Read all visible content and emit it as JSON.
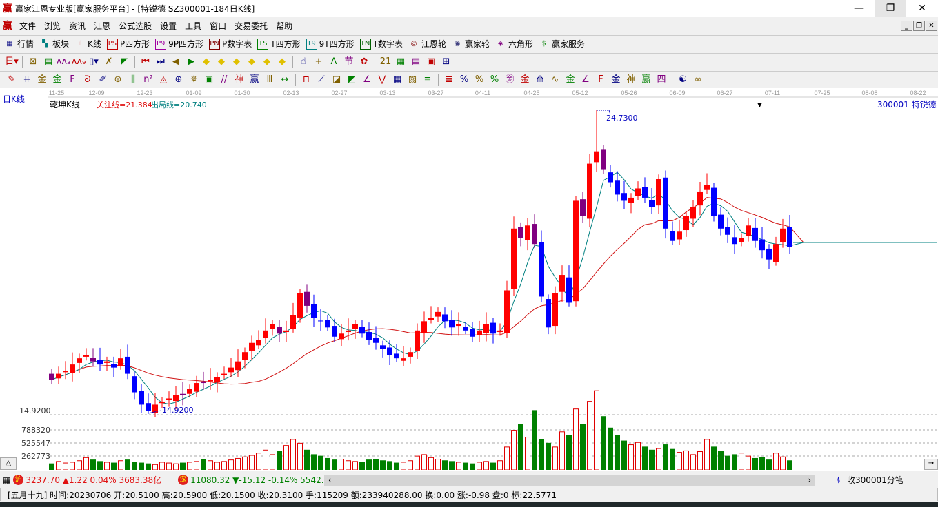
{
  "window": {
    "title": "赢家江恩专业版[赢家服务平台] - [特锐德  SZ300001-184日K线]",
    "logo": "赢"
  },
  "menu": [
    "文件",
    "浏览",
    "资讯",
    "江恩",
    "公式选股",
    "设置",
    "工具",
    "窗口",
    "交易委托",
    "帮助"
  ],
  "toolbar1": [
    {
      "icon": "grid",
      "glyph": "▦",
      "label": "行情",
      "color": "#000080"
    },
    {
      "icon": "blocks",
      "glyph": "▚",
      "label": "板块",
      "color": "#008080"
    },
    {
      "icon": "kline",
      "glyph": "ıl",
      "label": "K线",
      "color": "#c00000"
    },
    {
      "icon": "ps",
      "glyph": "PS",
      "label": "P四方形",
      "color": "#c00000"
    },
    {
      "icon": "p9",
      "glyph": "P9",
      "label": "9P四方形",
      "color": "#a000a0"
    },
    {
      "icon": "pn",
      "glyph": "PN",
      "label": "P数字表",
      "color": "#800000"
    },
    {
      "icon": "ts",
      "glyph": "TS",
      "label": "T四方形",
      "color": "#008000"
    },
    {
      "icon": "t9",
      "glyph": "T9",
      "label": "9T四方形",
      "color": "#008080"
    },
    {
      "icon": "tn",
      "glyph": "TN",
      "label": "T数字表",
      "color": "#006000"
    },
    {
      "icon": "gann-wheel",
      "glyph": "◎",
      "label": "江恩轮",
      "color": "#800000"
    },
    {
      "icon": "winner-wheel",
      "glyph": "◉",
      "label": "赢家轮",
      "color": "#404080"
    },
    {
      "icon": "hexagon",
      "glyph": "◈",
      "label": "六角形",
      "color": "#800080"
    },
    {
      "icon": "dollar",
      "glyph": "$",
      "label": "赢家服务",
      "color": "#008000"
    }
  ],
  "toolbar2": [
    {
      "icon": "period-select",
      "glyph": "日▾"
    },
    {
      "icon": "sep"
    },
    {
      "icon": "pattern",
      "glyph": "⊠"
    },
    {
      "icon": "notes",
      "glyph": "▤"
    },
    {
      "icon": "wave3",
      "glyph": "ʌʌ₃"
    },
    {
      "icon": "wave9",
      "glyph": "ʌʌ₉"
    },
    {
      "icon": "candle-select",
      "glyph": "▯▾"
    },
    {
      "icon": "mark",
      "glyph": "✗"
    },
    {
      "icon": "spectrum",
      "glyph": "◤"
    },
    {
      "icon": "sep"
    },
    {
      "icon": "first",
      "glyph": "⏮"
    },
    {
      "icon": "last",
      "glyph": "⏭"
    },
    {
      "icon": "prev",
      "glyph": "◀"
    },
    {
      "icon": "next",
      "glyph": "▶"
    },
    {
      "icon": "left-diamond",
      "glyph": "◆"
    },
    {
      "icon": "right-diamond",
      "glyph": "◆"
    },
    {
      "icon": "expand-diamond",
      "glyph": "◆"
    },
    {
      "icon": "shrink-diamond",
      "glyph": "◆"
    },
    {
      "icon": "vshrink-diamond",
      "glyph": "◆"
    },
    {
      "icon": "vexpand-diamond",
      "glyph": "◆"
    },
    {
      "icon": "sep"
    },
    {
      "icon": "hand",
      "glyph": "☝"
    },
    {
      "icon": "crosshair",
      "glyph": "+"
    },
    {
      "icon": "line-draw",
      "glyph": "ᐱ"
    },
    {
      "icon": "festival",
      "glyph": "节"
    },
    {
      "icon": "chart-alt",
      "glyph": "✿"
    },
    {
      "icon": "sep"
    },
    {
      "icon": "calendar",
      "glyph": "21"
    },
    {
      "icon": "calculator",
      "glyph": "▦"
    },
    {
      "icon": "report",
      "glyph": "▤"
    },
    {
      "icon": "save",
      "glyph": "▣"
    },
    {
      "icon": "network",
      "glyph": "⊞"
    }
  ],
  "toolbar3": [
    {
      "icon": "pen",
      "glyph": "✎"
    },
    {
      "icon": "lines-h",
      "glyph": "⧺"
    },
    {
      "icon": "gold1",
      "glyph": "金"
    },
    {
      "icon": "gold2",
      "glyph": "金"
    },
    {
      "icon": "f-lines",
      "glyph": "F"
    },
    {
      "icon": "spiral",
      "glyph": "ᘐ"
    },
    {
      "icon": "fan-pen",
      "glyph": "✐"
    },
    {
      "icon": "circle-grid",
      "glyph": "⊜"
    },
    {
      "icon": "lines-v",
      "glyph": "⫼"
    },
    {
      "icon": "n2",
      "glyph": "n²"
    },
    {
      "icon": "triangle",
      "glyph": "◬"
    },
    {
      "icon": "target",
      "glyph": "⊕"
    },
    {
      "icon": "web",
      "glyph": "✵"
    },
    {
      "icon": "square-target",
      "glyph": "▣"
    },
    {
      "icon": "parallel",
      "glyph": "//"
    },
    {
      "icon": "shen",
      "glyph": "神"
    },
    {
      "icon": "ying",
      "glyph": "赢"
    },
    {
      "icon": "comb",
      "glyph": "Ⅲ"
    },
    {
      "icon": "measure",
      "glyph": "↔"
    },
    {
      "icon": "sep"
    },
    {
      "icon": "box",
      "glyph": "⊓"
    },
    {
      "icon": "fan-red",
      "glyph": "⟋"
    },
    {
      "icon": "box-arc",
      "glyph": "◪"
    },
    {
      "icon": "box-fan",
      "glyph": "◩"
    },
    {
      "icon": "angle",
      "glyph": "∠"
    },
    {
      "icon": "zigzag",
      "glyph": "⋁"
    },
    {
      "icon": "grid-red",
      "glyph": "▦"
    },
    {
      "icon": "grid-diag",
      "glyph": "▧"
    },
    {
      "icon": "multi-lines",
      "glyph": "≡"
    },
    {
      "icon": "sep"
    },
    {
      "icon": "bars",
      "glyph": "≣"
    },
    {
      "icon": "pct-red",
      "glyph": "%"
    },
    {
      "icon": "percent",
      "glyph": "%"
    },
    {
      "icon": "pct-lines",
      "glyph": "%"
    },
    {
      "icon": "gold-circle",
      "glyph": "㊎"
    },
    {
      "icon": "gold-lines",
      "glyph": "金"
    },
    {
      "icon": "fan-tool",
      "glyph": "⟰"
    },
    {
      "icon": "wave-box",
      "glyph": "∿"
    },
    {
      "icon": "gold-box",
      "glyph": "金"
    },
    {
      "icon": "angle-j",
      "glyph": "∠"
    },
    {
      "icon": "angle-f",
      "glyph": "F"
    },
    {
      "icon": "angle-gold",
      "glyph": "金"
    },
    {
      "icon": "angle-shen",
      "glyph": "神"
    },
    {
      "icon": "angle-ying",
      "glyph": "赢"
    },
    {
      "icon": "angle-four",
      "glyph": "四"
    },
    {
      "icon": "sep"
    },
    {
      "icon": "yin-yang",
      "glyph": "☯"
    },
    {
      "icon": "infinity",
      "glyph": "∞"
    }
  ],
  "chart": {
    "period_label": "日K线",
    "indicator_name": "乾坤K线",
    "focus_line": "关注线=21.384",
    "exit_line": "出局线=20.740",
    "stock": "300001  特锐德",
    "max_label": "24.7300",
    "min_label": "14.9200",
    "price_axis_label": "14.9200",
    "volume_ticks": [
      "788320",
      "525547",
      "262773"
    ],
    "dates": [
      "11-25",
      "12-09",
      "12-23",
      "01-09",
      "01-30",
      "02-13",
      "02-27",
      "03-13",
      "03-27",
      "04-11",
      "04-25",
      "05-12",
      "05-26",
      "06-09",
      "06-27",
      "07-11",
      "07-25",
      "08-08",
      "08-22"
    ]
  },
  "chart_data": {
    "type": "candlestick",
    "title": "SZ300001-184日K线",
    "price_range": [
      14.92,
      24.73
    ],
    "first_open": 16.2,
    "close": [
      16.0,
      16.2,
      16.3,
      16.5,
      16.7,
      16.8,
      16.6,
      16.5,
      16.6,
      16.4,
      16.7,
      16.2,
      15.6,
      15.2,
      15.0,
      15.2,
      15.3,
      15.4,
      15.5,
      15.5,
      15.7,
      15.9,
      15.9,
      16.0,
      16.1,
      16.2,
      16.4,
      16.6,
      16.9,
      17.2,
      17.3,
      17.6,
      17.8,
      17.5,
      17.6,
      18.1,
      18.8,
      18.4,
      18.0,
      17.9,
      17.7,
      17.4,
      17.5,
      17.6,
      17.8,
      17.5,
      17.3,
      17.2,
      17.0,
      16.8,
      16.7,
      16.7,
      16.9,
      17.6,
      17.9,
      18.0,
      18.2,
      17.9,
      17.7,
      17.8,
      17.6,
      17.4,
      17.6,
      17.8,
      17.5,
      17.6,
      18.9,
      20.9,
      20.6,
      21.0,
      20.4,
      18.7,
      17.7,
      18.8,
      19.4,
      18.5,
      21.8,
      21.3,
      23.0,
      23.4,
      22.8,
      22.4,
      22.0,
      21.8,
      21.9,
      22.2,
      21.9,
      21.6,
      22.5,
      20.9,
      20.5,
      20.8,
      21.3,
      21.6,
      22.1,
      22.3,
      21.3,
      20.9,
      20.7,
      20.4,
      20.6,
      21.0,
      20.5,
      20.2,
      19.9,
      20.4,
      20.9,
      20.31
    ],
    "volume_k": [
      80,
      110,
      90,
      100,
      120,
      160,
      130,
      110,
      100,
      90,
      120,
      130,
      100,
      90,
      80,
      70,
      100,
      90,
      80,
      90,
      100,
      110,
      140,
      120,
      100,
      110,
      130,
      150,
      170,
      190,
      220,
      260,
      200,
      240,
      320,
      400,
      350,
      260,
      200,
      180,
      150,
      130,
      140,
      120,
      110,
      100,
      130,
      140,
      120,
      110,
      90,
      100,
      120,
      180,
      200,
      160,
      140,
      120,
      110,
      100,
      90,
      80,
      100,
      110,
      90,
      120,
      300,
      520,
      600,
      430,
      780,
      400,
      350,
      300,
      500,
      450,
      800,
      600,
      900,
      1040,
      700,
      550,
      450,
      380,
      330,
      360,
      300,
      260,
      280,
      330,
      270,
      230,
      250,
      200,
      240,
      400,
      300,
      240,
      180,
      200,
      220,
      180,
      150,
      160,
      130,
      220,
      170,
      120
    ]
  },
  "ticker": {
    "sh_badge": "沪",
    "sh": "3237.70 ▲1.22 0.04% 3683.38亿",
    "sz_badge": "深",
    "sz": "11080.32 ▼-15.12 -0.14% 5542.38",
    "right": "收300001分笔"
  },
  "status": "[五月十九] 时间:20230706 开:20.5100 高:20.5900 低:20.1500 收:20.3100 手:115209 额:233940288.00 换:0.00 涨:-0.98 盘:0 标:22.5771"
}
